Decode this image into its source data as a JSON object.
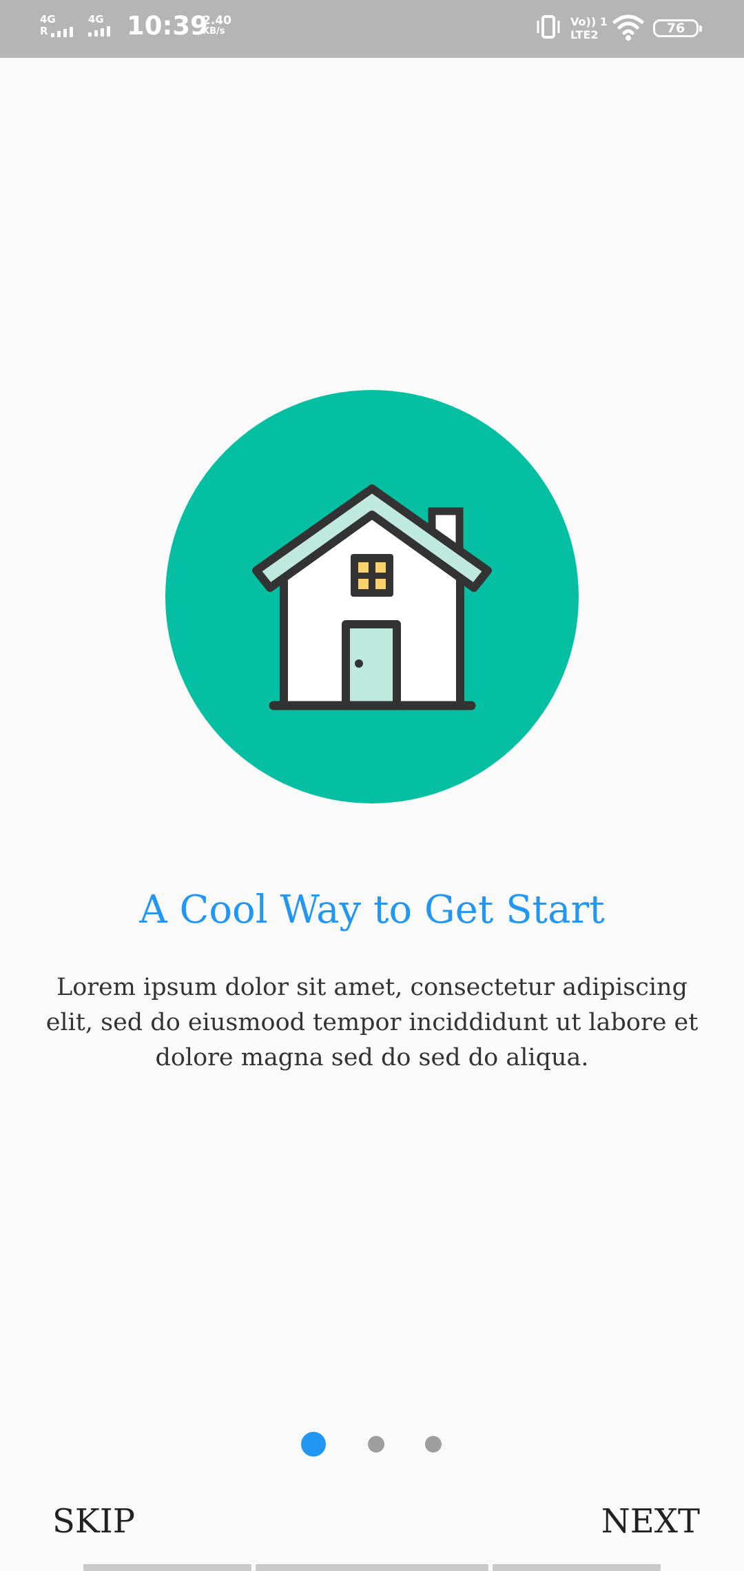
{
  "status_bar": {
    "sim1_network": "4G",
    "sim1_roaming": "R",
    "sim2_network": "4G",
    "time": "10:39",
    "speed_value": "2.40",
    "speed_unit": "KB/s",
    "volte_label": "Vo)) 1",
    "lte_label": "LTE2",
    "battery": "76",
    "icons": [
      "signal-bars",
      "vibrate-icon",
      "wifi-icon",
      "battery-icon"
    ]
  },
  "onboarding": {
    "illustration": "house-icon",
    "title": "A Cool Way to Get Start",
    "description": "Lorem ipsum dolor sit amet, consectetur adipiscing elit, sed do eiusmood tempor inciddidunt ut labore et dolore magna sed do sed do aliqua.",
    "page_count": 3,
    "current_page": 1
  },
  "footer": {
    "skip_label": "SKIP",
    "next_label": "NEXT"
  },
  "colors": {
    "accent": "#2196f3",
    "illustration_bg": "#05bfa2",
    "house_outline": "#333333",
    "roof_door": "#bfe9dc",
    "window": "#f9d26b",
    "status_bar": "#b5b5b5",
    "inactive_dot": "#9e9e9e"
  }
}
